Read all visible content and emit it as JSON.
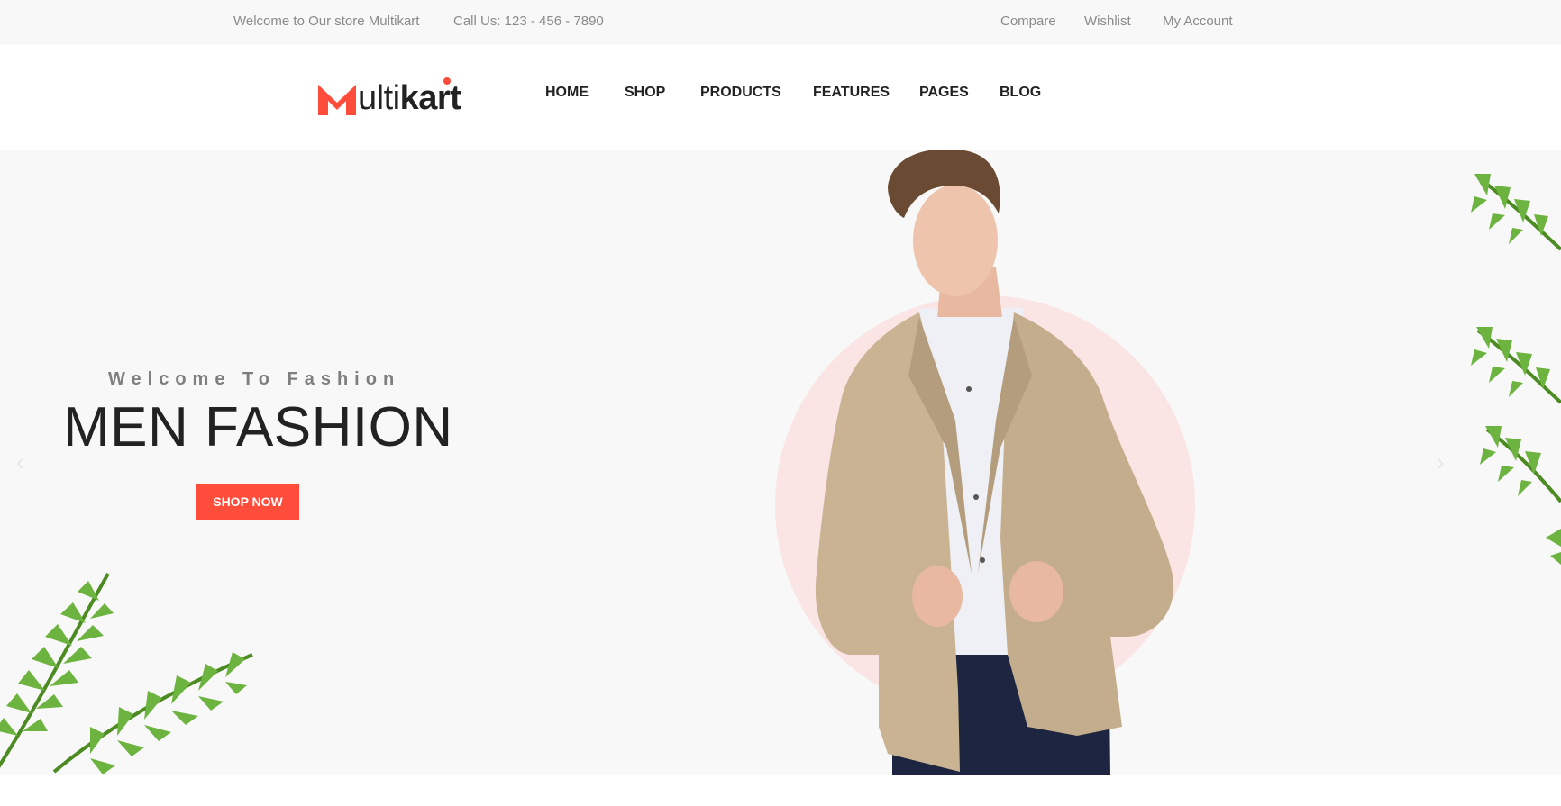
{
  "topbar": {
    "welcome": "Welcome to Our store Multikart",
    "call": "Call Us: 123 - 456 - 7890",
    "compare": "Compare",
    "wishlist": "Wishlist",
    "account": "My Account"
  },
  "logo": {
    "text_light": "ulti",
    "text_bold": "kart",
    "accent": "#ff4c3b"
  },
  "nav": {
    "items": [
      "HOME",
      "SHOP",
      "PRODUCTS",
      "FEATURES",
      "PAGES",
      "BLOG"
    ]
  },
  "hero": {
    "subtitle": "Welcome To Fashion",
    "title": "MEN FASHION",
    "cta": "SHOP NOW",
    "prev_icon": "chevron-left-icon",
    "next_icon": "chevron-right-icon"
  },
  "colors": {
    "accent": "#ff4c3b",
    "hero_bg": "#f8f8f8",
    "circle": "#fae4e4",
    "leaf": "#5f9f2a",
    "jacket": "#c9b393",
    "pants": "#1d2540"
  }
}
